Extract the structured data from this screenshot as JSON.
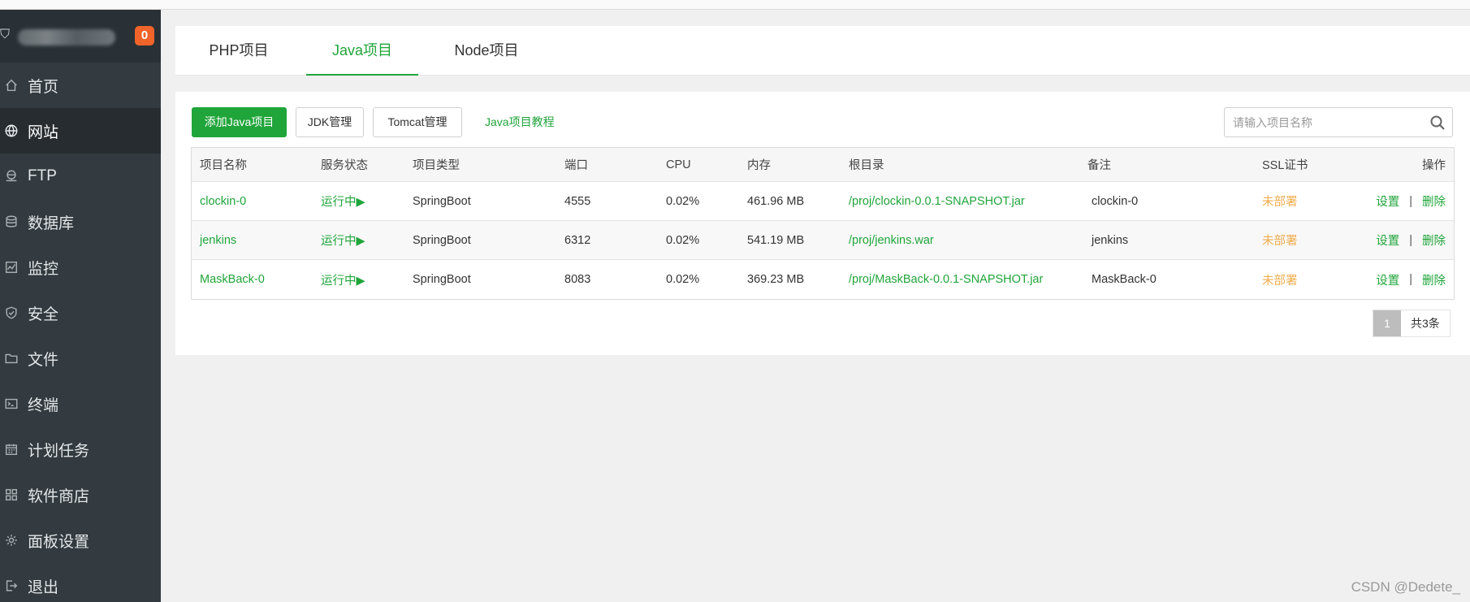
{
  "sidebar": {
    "badge": "0",
    "items": [
      {
        "label": "首页",
        "icon": "home-icon"
      },
      {
        "label": "网站",
        "icon": "globe-icon",
        "active": true
      },
      {
        "label": "FTP",
        "icon": "ftp-icon"
      },
      {
        "label": "数据库",
        "icon": "database-icon"
      },
      {
        "label": "监控",
        "icon": "monitor-icon"
      },
      {
        "label": "安全",
        "icon": "shield-icon"
      },
      {
        "label": "文件",
        "icon": "folder-icon"
      },
      {
        "label": "终端",
        "icon": "terminal-icon"
      },
      {
        "label": "计划任务",
        "icon": "calendar-icon"
      },
      {
        "label": "软件商店",
        "icon": "apps-icon"
      },
      {
        "label": "面板设置",
        "icon": "gear-icon"
      },
      {
        "label": "退出",
        "icon": "logout-icon"
      }
    ]
  },
  "tabs": [
    {
      "label": "PHP项目"
    },
    {
      "label": "Java项目",
      "active": true
    },
    {
      "label": "Node项目"
    }
  ],
  "toolbar": {
    "add_label": "添加Java项目",
    "jdk_label": "JDK管理",
    "tomcat_label": "Tomcat管理",
    "tutorial_label": "Java项目教程",
    "search_placeholder": "请输入项目名称"
  },
  "table": {
    "headers": {
      "name": "项目名称",
      "status": "服务状态",
      "type": "项目类型",
      "port": "端口",
      "cpu": "CPU",
      "mem": "内存",
      "root": "根目录",
      "note": "备注",
      "ssl": "SSL证书",
      "ops": "操作"
    },
    "rows": [
      {
        "name": "clockin-0",
        "status": "运行中▶",
        "type": "SpringBoot",
        "port": "4555",
        "cpu": "0.02%",
        "mem": "461.96 MB",
        "root": "/proj/clockin-0.0.1-SNAPSHOT.jar",
        "note": "clockin-0",
        "ssl": "未部署",
        "op_settings": "设置",
        "op_sep": "|",
        "op_delete": "删除"
      },
      {
        "name": "jenkins",
        "status": "运行中▶",
        "type": "SpringBoot",
        "port": "6312",
        "cpu": "0.02%",
        "mem": "541.19 MB",
        "root": "/proj/jenkins.war",
        "note": "jenkins",
        "ssl": "未部署",
        "op_settings": "设置",
        "op_sep": "|",
        "op_delete": "删除"
      },
      {
        "name": "MaskBack-0",
        "status": "运行中▶",
        "type": "SpringBoot",
        "port": "8083",
        "cpu": "0.02%",
        "mem": "369.23 MB",
        "root": "/proj/MaskBack-0.0.1-SNAPSHOT.jar",
        "note": "MaskBack-0",
        "ssl": "未部署",
        "op_settings": "设置",
        "op_sep": "|",
        "op_delete": "删除"
      }
    ]
  },
  "pager": {
    "current_page": "1",
    "total_label": "共3条"
  },
  "watermark": "CSDN @Dedete_",
  "colors": {
    "accent": "#20a53a",
    "sidebar_bg": "#333b40",
    "badge": "#f0642a",
    "ssl_warning": "#f0ad4e"
  }
}
